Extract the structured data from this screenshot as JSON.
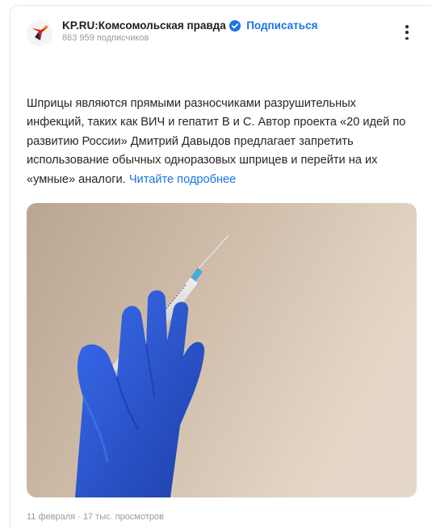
{
  "channel": {
    "name": "KP.RU:Комсомольская правда",
    "subscribe_label": "Подписаться",
    "subscribers": "863 959 подписчиков"
  },
  "post": {
    "text": "Шприцы являются прямыми разносчиками разрушительных инфекций, таких как ВИЧ и гепатит В и С. Автор проекта «20 идей по развитию России» Дмитрий Давыдов предлагает запретить использование обычных одноразовых шприцев и перейти на их «умные» аналоги.",
    "read_more": "Читайте подробнее",
    "meta": "11 февраля · 17 тыс. просмотров"
  },
  "icons": {
    "logo": "kp-logo-icon",
    "verified": "verified-check-icon",
    "menu": "more-vertical-icon"
  },
  "colors": {
    "accent": "#1a73e8",
    "image_background": "#cdbba8",
    "glove": "#2a54c8"
  }
}
